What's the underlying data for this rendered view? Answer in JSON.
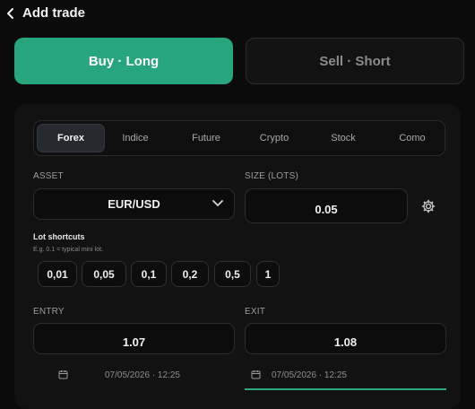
{
  "header": {
    "title": "Add trade"
  },
  "sides": {
    "buy_label": "Buy · Long",
    "sell_label": "Sell · Short"
  },
  "tabs": [
    {
      "label": "Forex",
      "active": true
    },
    {
      "label": "Indice",
      "active": false
    },
    {
      "label": "Future",
      "active": false
    },
    {
      "label": "Crypto",
      "active": false
    },
    {
      "label": "Stock",
      "active": false
    },
    {
      "label": "Como",
      "active": false
    }
  ],
  "asset": {
    "label": "ASSET",
    "value": "EUR/USD"
  },
  "size": {
    "label": "SIZE (LOTS)",
    "value": "0.05"
  },
  "lot_shortcuts": {
    "title": "Lot shortcuts",
    "note": "E.g. 0.1 = typical mini lot.",
    "options": [
      "0,01",
      "0,05",
      "0,1",
      "0,2",
      "0,5",
      "1"
    ]
  },
  "entry": {
    "label": "ENTRY",
    "value": "1.07",
    "date": "07/05/2026 · 12:25"
  },
  "exit": {
    "label": "EXIT",
    "value": "1.08",
    "date": "07/05/2026 · 12:25"
  },
  "colors": {
    "accent": "#27a57c",
    "background": "#0b0b0c",
    "card": "#121213"
  },
  "icons": {
    "back": "chevron-left-icon",
    "dropdown": "chevron-down-icon",
    "settings": "gear-icon",
    "calendar": "calendar-icon"
  }
}
